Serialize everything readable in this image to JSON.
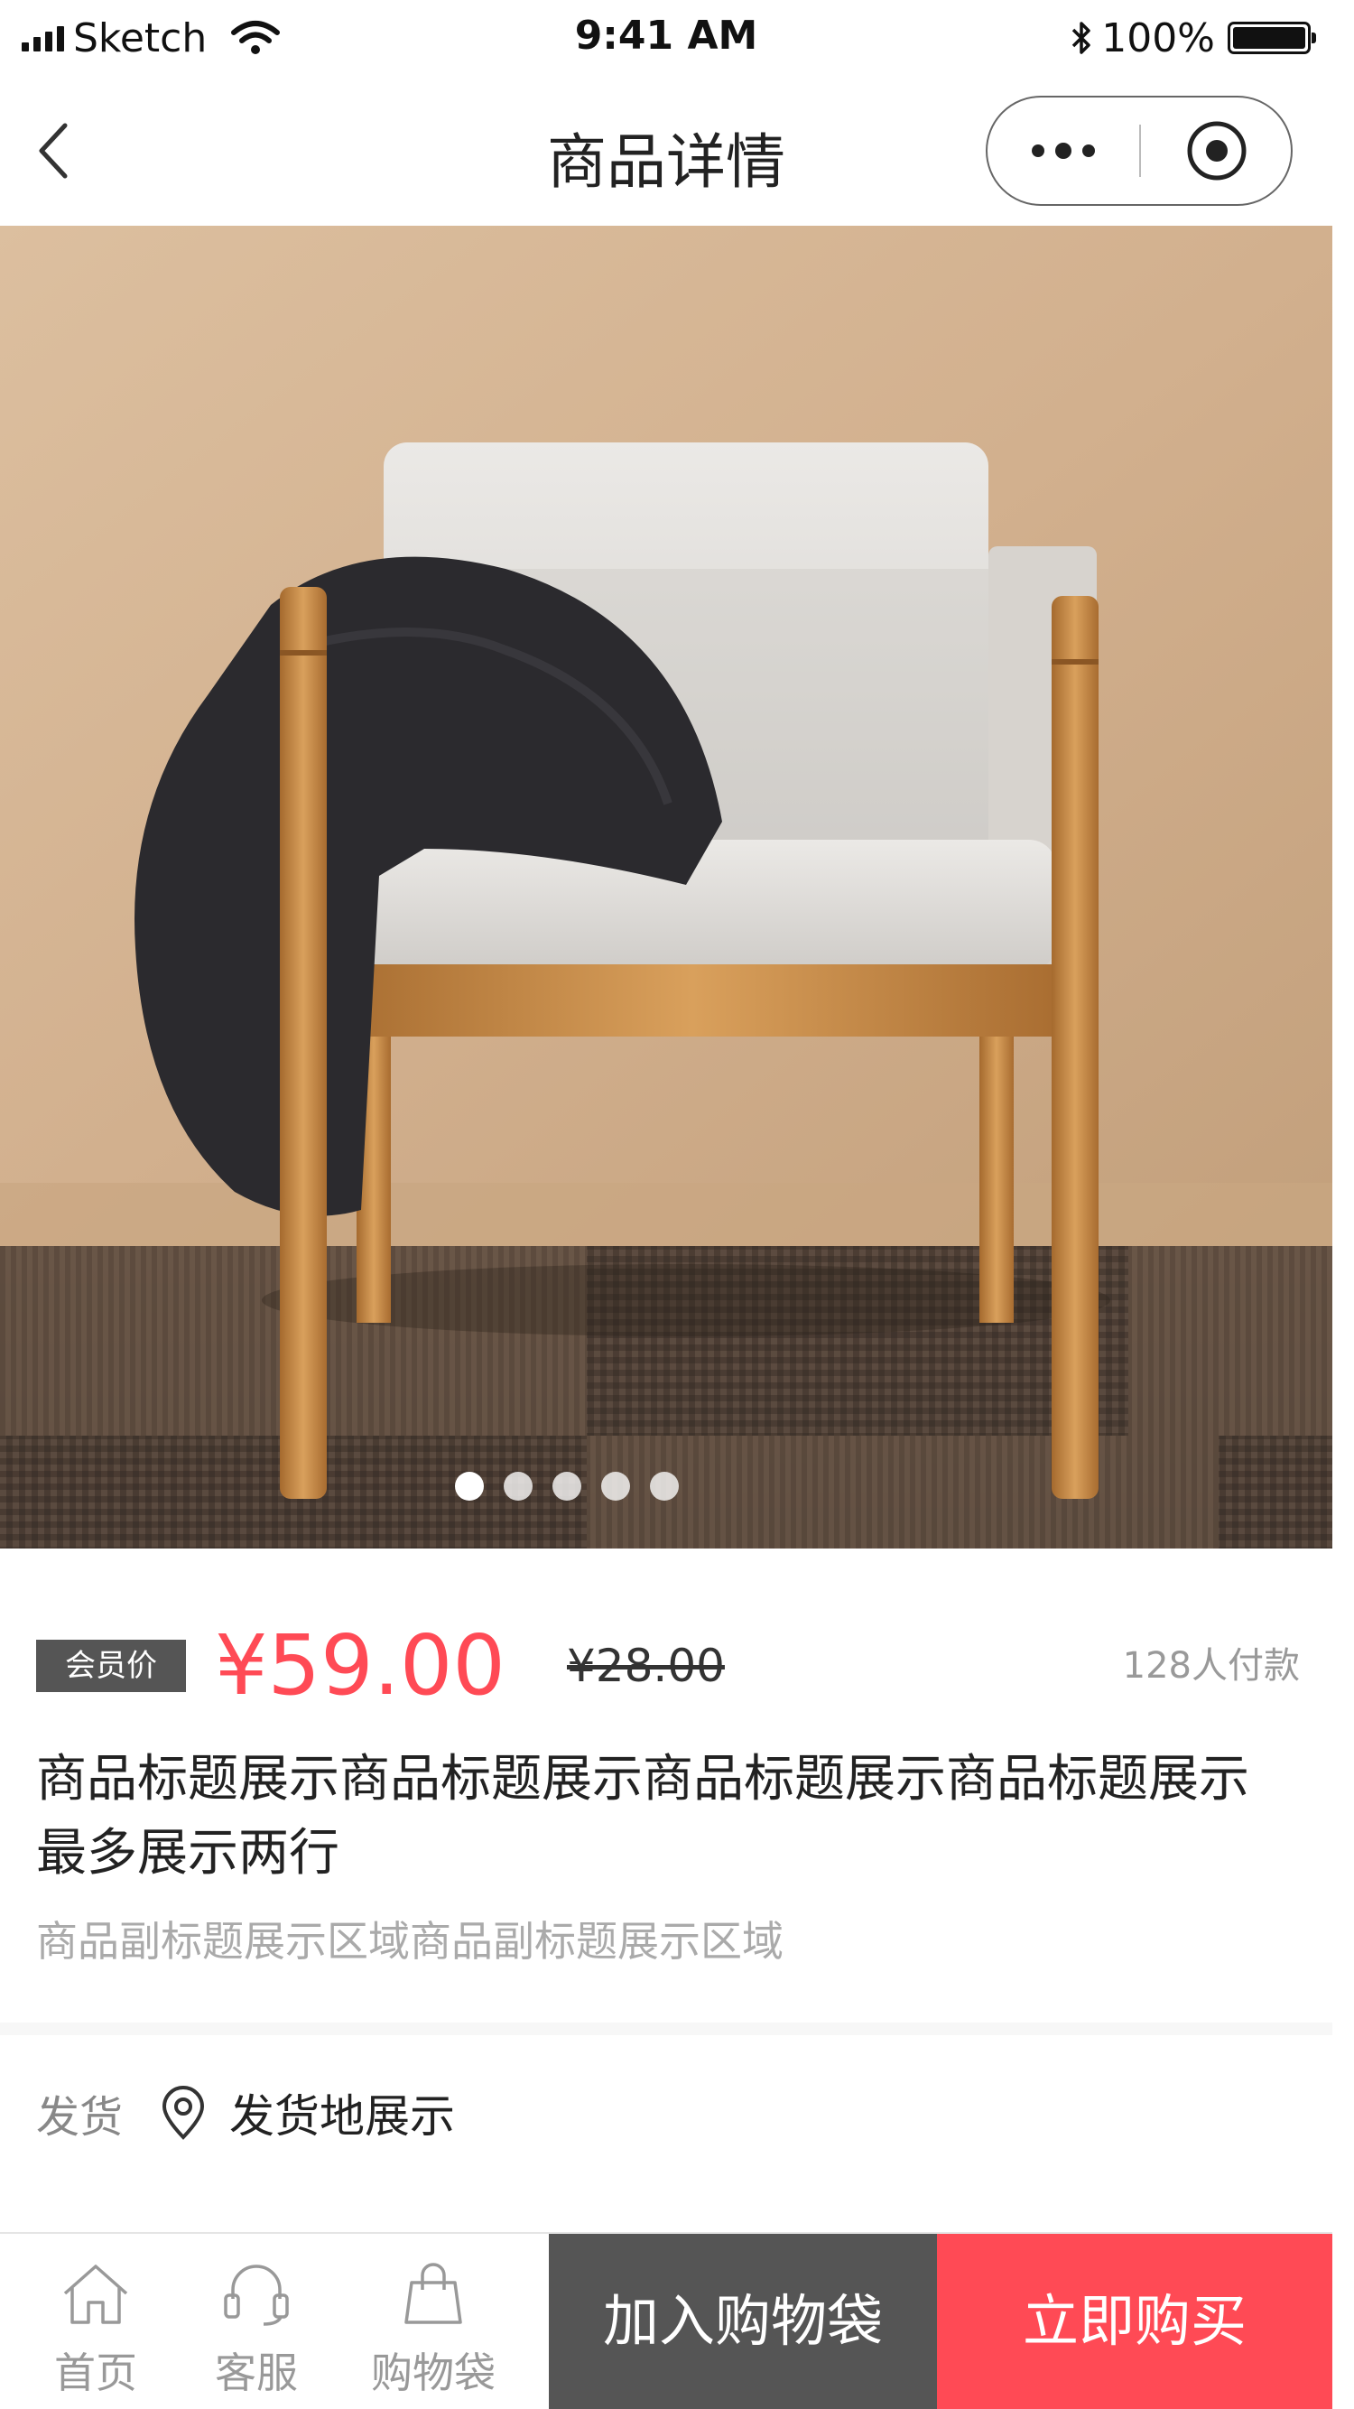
{
  "status_bar": {
    "carrier": "Sketch",
    "time": "9:41 AM",
    "battery_pct": "100%",
    "battery_level": 1.0,
    "icons": [
      "signal-icon",
      "wifi-icon",
      "bluetooth-icon",
      "battery-icon"
    ]
  },
  "nav": {
    "title": "商品详情",
    "back_icon": "chevron-left-icon",
    "more_icon": "more-dots-icon",
    "close_icon": "target-close-icon"
  },
  "gallery": {
    "image_count": 5,
    "active_index": 0
  },
  "product": {
    "member_label": "会员价",
    "price": "¥59.00",
    "original_price": "¥28.00",
    "pay_count": "128人付款",
    "title": "商品标题展示商品标题展示商品标题展示商品标题展示最多展示两行",
    "subtitle": "商品副标题展示区域商品副标题展示区域"
  },
  "shipping": {
    "label": "发货",
    "value": "发货地展示",
    "icon": "location-pin-icon"
  },
  "bottom_bar": {
    "tabs": [
      {
        "label": "首页",
        "icon": "home-icon"
      },
      {
        "label": "客服",
        "icon": "headset-icon"
      },
      {
        "label": "购物袋",
        "icon": "shopping-bag-icon"
      }
    ],
    "add_to_cart": "加入购物袋",
    "buy_now": "立即购买"
  },
  "colors": {
    "accent_red": "#ff4a55",
    "cart_button": "#555555",
    "member_badge": "#555555"
  }
}
